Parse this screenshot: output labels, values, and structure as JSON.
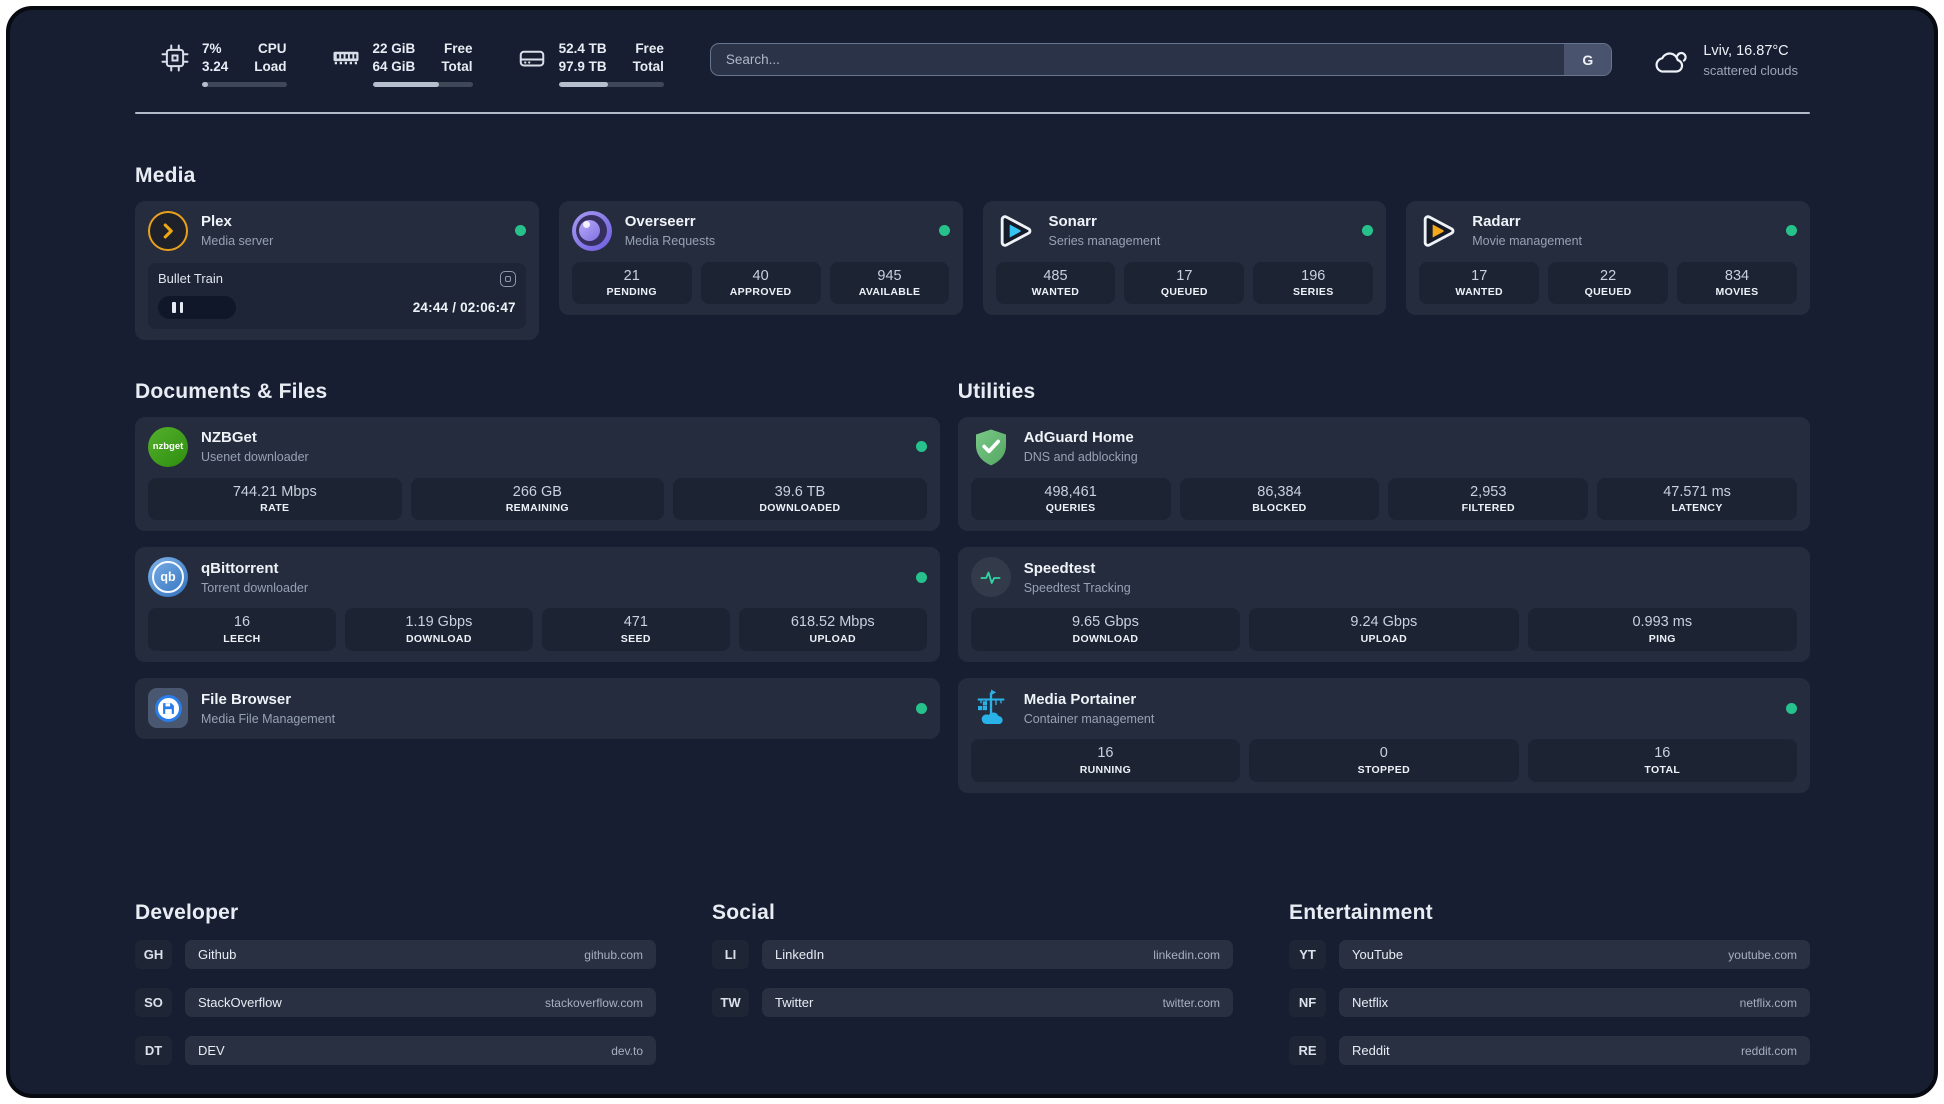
{
  "colors": {
    "status_green": "#27c28b",
    "plex_gold": "#e9a01c",
    "overseerr_purple": "#6c5ce0",
    "sonarr_cyan": "#36c3f1",
    "radarr_gold": "#f2a818",
    "nzbget_green": "#3fa317",
    "adguard_green": "#63b56c",
    "qbittorrent_blue": "#3d7fc6",
    "speedtest_green": "#2fd6a3",
    "filebrowser_blue": "#2a7ce9",
    "portainer_blue": "#29b2e8"
  },
  "topbar": {
    "system": [
      {
        "icon": "cpu-icon",
        "value1": "7%",
        "value2": "3.24",
        "label1": "CPU",
        "label2": "Load",
        "progress": 7
      },
      {
        "icon": "memory-icon",
        "value1": "22 GiB",
        "value2": "64 GiB",
        "label1": "Free",
        "label2": "Total",
        "progress": 66
      },
      {
        "icon": "hard-drive-icon",
        "value1": "52.4 TB",
        "value2": "97.9 TB",
        "label1": "Free",
        "label2": "Total",
        "progress": 47
      }
    ],
    "search": {
      "placeholder": "Search...",
      "button": "G"
    },
    "weather": {
      "icon": "cloud-icon",
      "location_temp": "Lviv, 16.87°C",
      "condition": "scattered clouds"
    }
  },
  "media": {
    "title": "Media",
    "cards": [
      {
        "name": "Plex",
        "sub": "Media server",
        "icon": "plex-icon",
        "online": true,
        "player": {
          "title": "Bullet Train",
          "time": "24:44 / 02:06:47"
        }
      },
      {
        "name": "Overseerr",
        "sub": "Media Requests",
        "icon": "overseerr-icon",
        "online": true,
        "stats": [
          {
            "v": "21",
            "l": "PENDING"
          },
          {
            "v": "40",
            "l": "APPROVED"
          },
          {
            "v": "945",
            "l": "AVAILABLE"
          }
        ]
      },
      {
        "name": "Sonarr",
        "sub": "Series management",
        "icon": "sonarr-icon",
        "online": true,
        "stats": [
          {
            "v": "485",
            "l": "WANTED"
          },
          {
            "v": "17",
            "l": "QUEUED"
          },
          {
            "v": "196",
            "l": "SERIES"
          }
        ]
      },
      {
        "name": "Radarr",
        "sub": "Movie management",
        "icon": "radarr-icon",
        "online": true,
        "stats": [
          {
            "v": "17",
            "l": "WANTED"
          },
          {
            "v": "22",
            "l": "QUEUED"
          },
          {
            "v": "834",
            "l": "MOVIES"
          }
        ]
      }
    ]
  },
  "documents": {
    "title": "Documents & Files",
    "cards": [
      {
        "name": "NZBGet",
        "sub": "Usenet downloader",
        "icon": "nzbget-icon",
        "online": true,
        "stats": [
          {
            "v": "744.21 Mbps",
            "l": "RATE"
          },
          {
            "v": "266 GB",
            "l": "REMAINING"
          },
          {
            "v": "39.6 TB",
            "l": "DOWNLOADED"
          }
        ]
      },
      {
        "name": "qBittorrent",
        "sub": "Torrent downloader",
        "icon": "qbittorrent-icon",
        "online": true,
        "stats": [
          {
            "v": "16",
            "l": "LEECH"
          },
          {
            "v": "1.19 Gbps",
            "l": "DOWNLOAD"
          },
          {
            "v": "471",
            "l": "SEED"
          },
          {
            "v": "618.52 Mbps",
            "l": "UPLOAD"
          }
        ]
      },
      {
        "name": "File Browser",
        "sub": "Media File Management",
        "icon": "filebrowser-icon",
        "online": true,
        "stats": []
      }
    ]
  },
  "utilities": {
    "title": "Utilities",
    "cards": [
      {
        "name": "AdGuard Home",
        "sub": "DNS and adblocking",
        "icon": "adguard-icon",
        "online": false,
        "stats": [
          {
            "v": "498,461",
            "l": "QUERIES"
          },
          {
            "v": "86,384",
            "l": "BLOCKED"
          },
          {
            "v": "2,953",
            "l": "FILTERED"
          },
          {
            "v": "47.571 ms",
            "l": "LATENCY"
          }
        ]
      },
      {
        "name": "Speedtest",
        "sub": "Speedtest Tracking",
        "icon": "speedtest-icon",
        "online": false,
        "stats": [
          {
            "v": "9.65 Gbps",
            "l": "DOWNLOAD"
          },
          {
            "v": "9.24 Gbps",
            "l": "UPLOAD"
          },
          {
            "v": "0.993 ms",
            "l": "PING"
          }
        ]
      },
      {
        "name": "Media Portainer",
        "sub": "Container management",
        "icon": "portainer-icon",
        "online": true,
        "stats": [
          {
            "v": "16",
            "l": "RUNNING"
          },
          {
            "v": "0",
            "l": "STOPPED"
          },
          {
            "v": "16",
            "l": "TOTAL"
          }
        ]
      }
    ]
  },
  "links": {
    "groups": [
      {
        "title": "Developer",
        "items": [
          {
            "abbr": "GH",
            "name": "Github",
            "url": "github.com"
          },
          {
            "abbr": "SO",
            "name": "StackOverflow",
            "url": "stackoverflow.com"
          },
          {
            "abbr": "DT",
            "name": "DEV",
            "url": "dev.to"
          }
        ]
      },
      {
        "title": "Social",
        "items": [
          {
            "abbr": "LI",
            "name": "LinkedIn",
            "url": "linkedin.com"
          },
          {
            "abbr": "TW",
            "name": "Twitter",
            "url": "twitter.com"
          }
        ]
      },
      {
        "title": "Entertainment",
        "items": [
          {
            "abbr": "YT",
            "name": "YouTube",
            "url": "youtube.com"
          },
          {
            "abbr": "NF",
            "name": "Netflix",
            "url": "netflix.com"
          },
          {
            "abbr": "RE",
            "name": "Reddit",
            "url": "reddit.com"
          }
        ]
      }
    ]
  }
}
